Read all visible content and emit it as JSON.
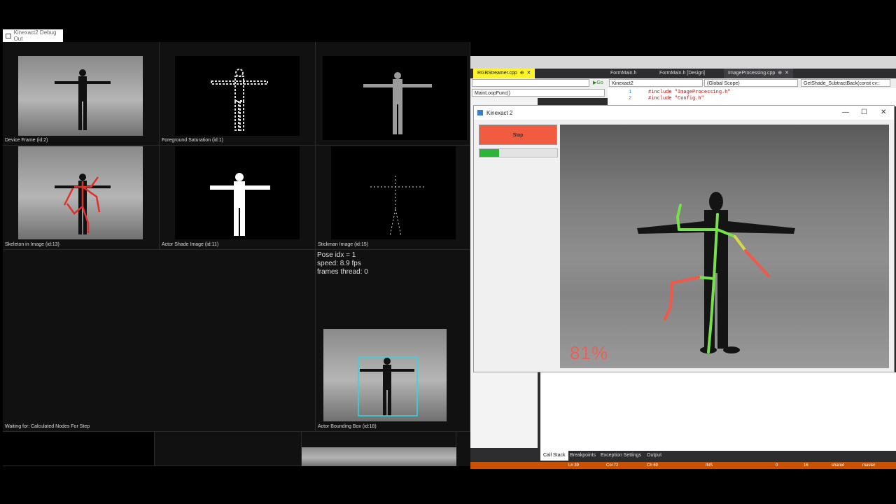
{
  "debug_window": {
    "title": "Kinexact2 Debug Out",
    "captions": {
      "device_frame": "Device Frame (id:2)",
      "foreground_saturation": "Foreground Saturation (id:1)",
      "skeleton_in_image": "Skeleton in Image (id:13)",
      "actor_shade_image": "Actor Shade Image (id:11)",
      "stickman_image": "Stickman Image (id:15)",
      "waiting_for": "Waiting for: Calculated Nodes For Step",
      "actor_bounding_box": "Actor Bounding Box (id:18)"
    },
    "info": {
      "pose_idx": "Pose idx = 1",
      "speed": "speed: 8.9 fps",
      "frames_thread": "frames thread: 0"
    }
  },
  "visual_studio": {
    "tabs": [
      "RGBStreamer.cpp",
      "FormMain.h",
      "FormMain.h [Design]",
      "ImageProcessing.cpp"
    ],
    "go_label": "Go",
    "dropdowns": {
      "project": "Kinexact2",
      "scope": "(Global Scope)",
      "function": "GetShade_SubtractBack(const cv::",
      "left_function": "MainLoopFunc()"
    },
    "code_lines": [
      {
        "num": "1",
        "text": "#include \"ImageProcessing.h\""
      },
      {
        "num": "2",
        "text": "#include \"Config.h\""
      }
    ],
    "bottom_tabs": [
      "Call Stack",
      "Breakpoints",
      "Exception Settings",
      "Output"
    ],
    "status": {
      "ln": "Ln 39",
      "col": "Col 72",
      "ch": "Ch 69",
      "ins": "INS",
      "zero": "0",
      "sixteen": "16",
      "repo": "shared",
      "branch": "master"
    }
  },
  "kinexact_window": {
    "title": "Kinexact 2",
    "stop_label": "Stop",
    "progress": 0.25,
    "match_percent": "81%",
    "min_icon": "minimize-icon",
    "max_icon": "maximize-icon",
    "close_icon": "close-icon"
  },
  "colors": {
    "stop_button": "#f15b40",
    "progress_fill": "#2db53a",
    "percent_text": "#e8625a",
    "skeleton_green": "#77e04a",
    "skeleton_red": "#f0584a",
    "bounding_box": "#2fd8e6",
    "status_bar": "#ca5100"
  }
}
